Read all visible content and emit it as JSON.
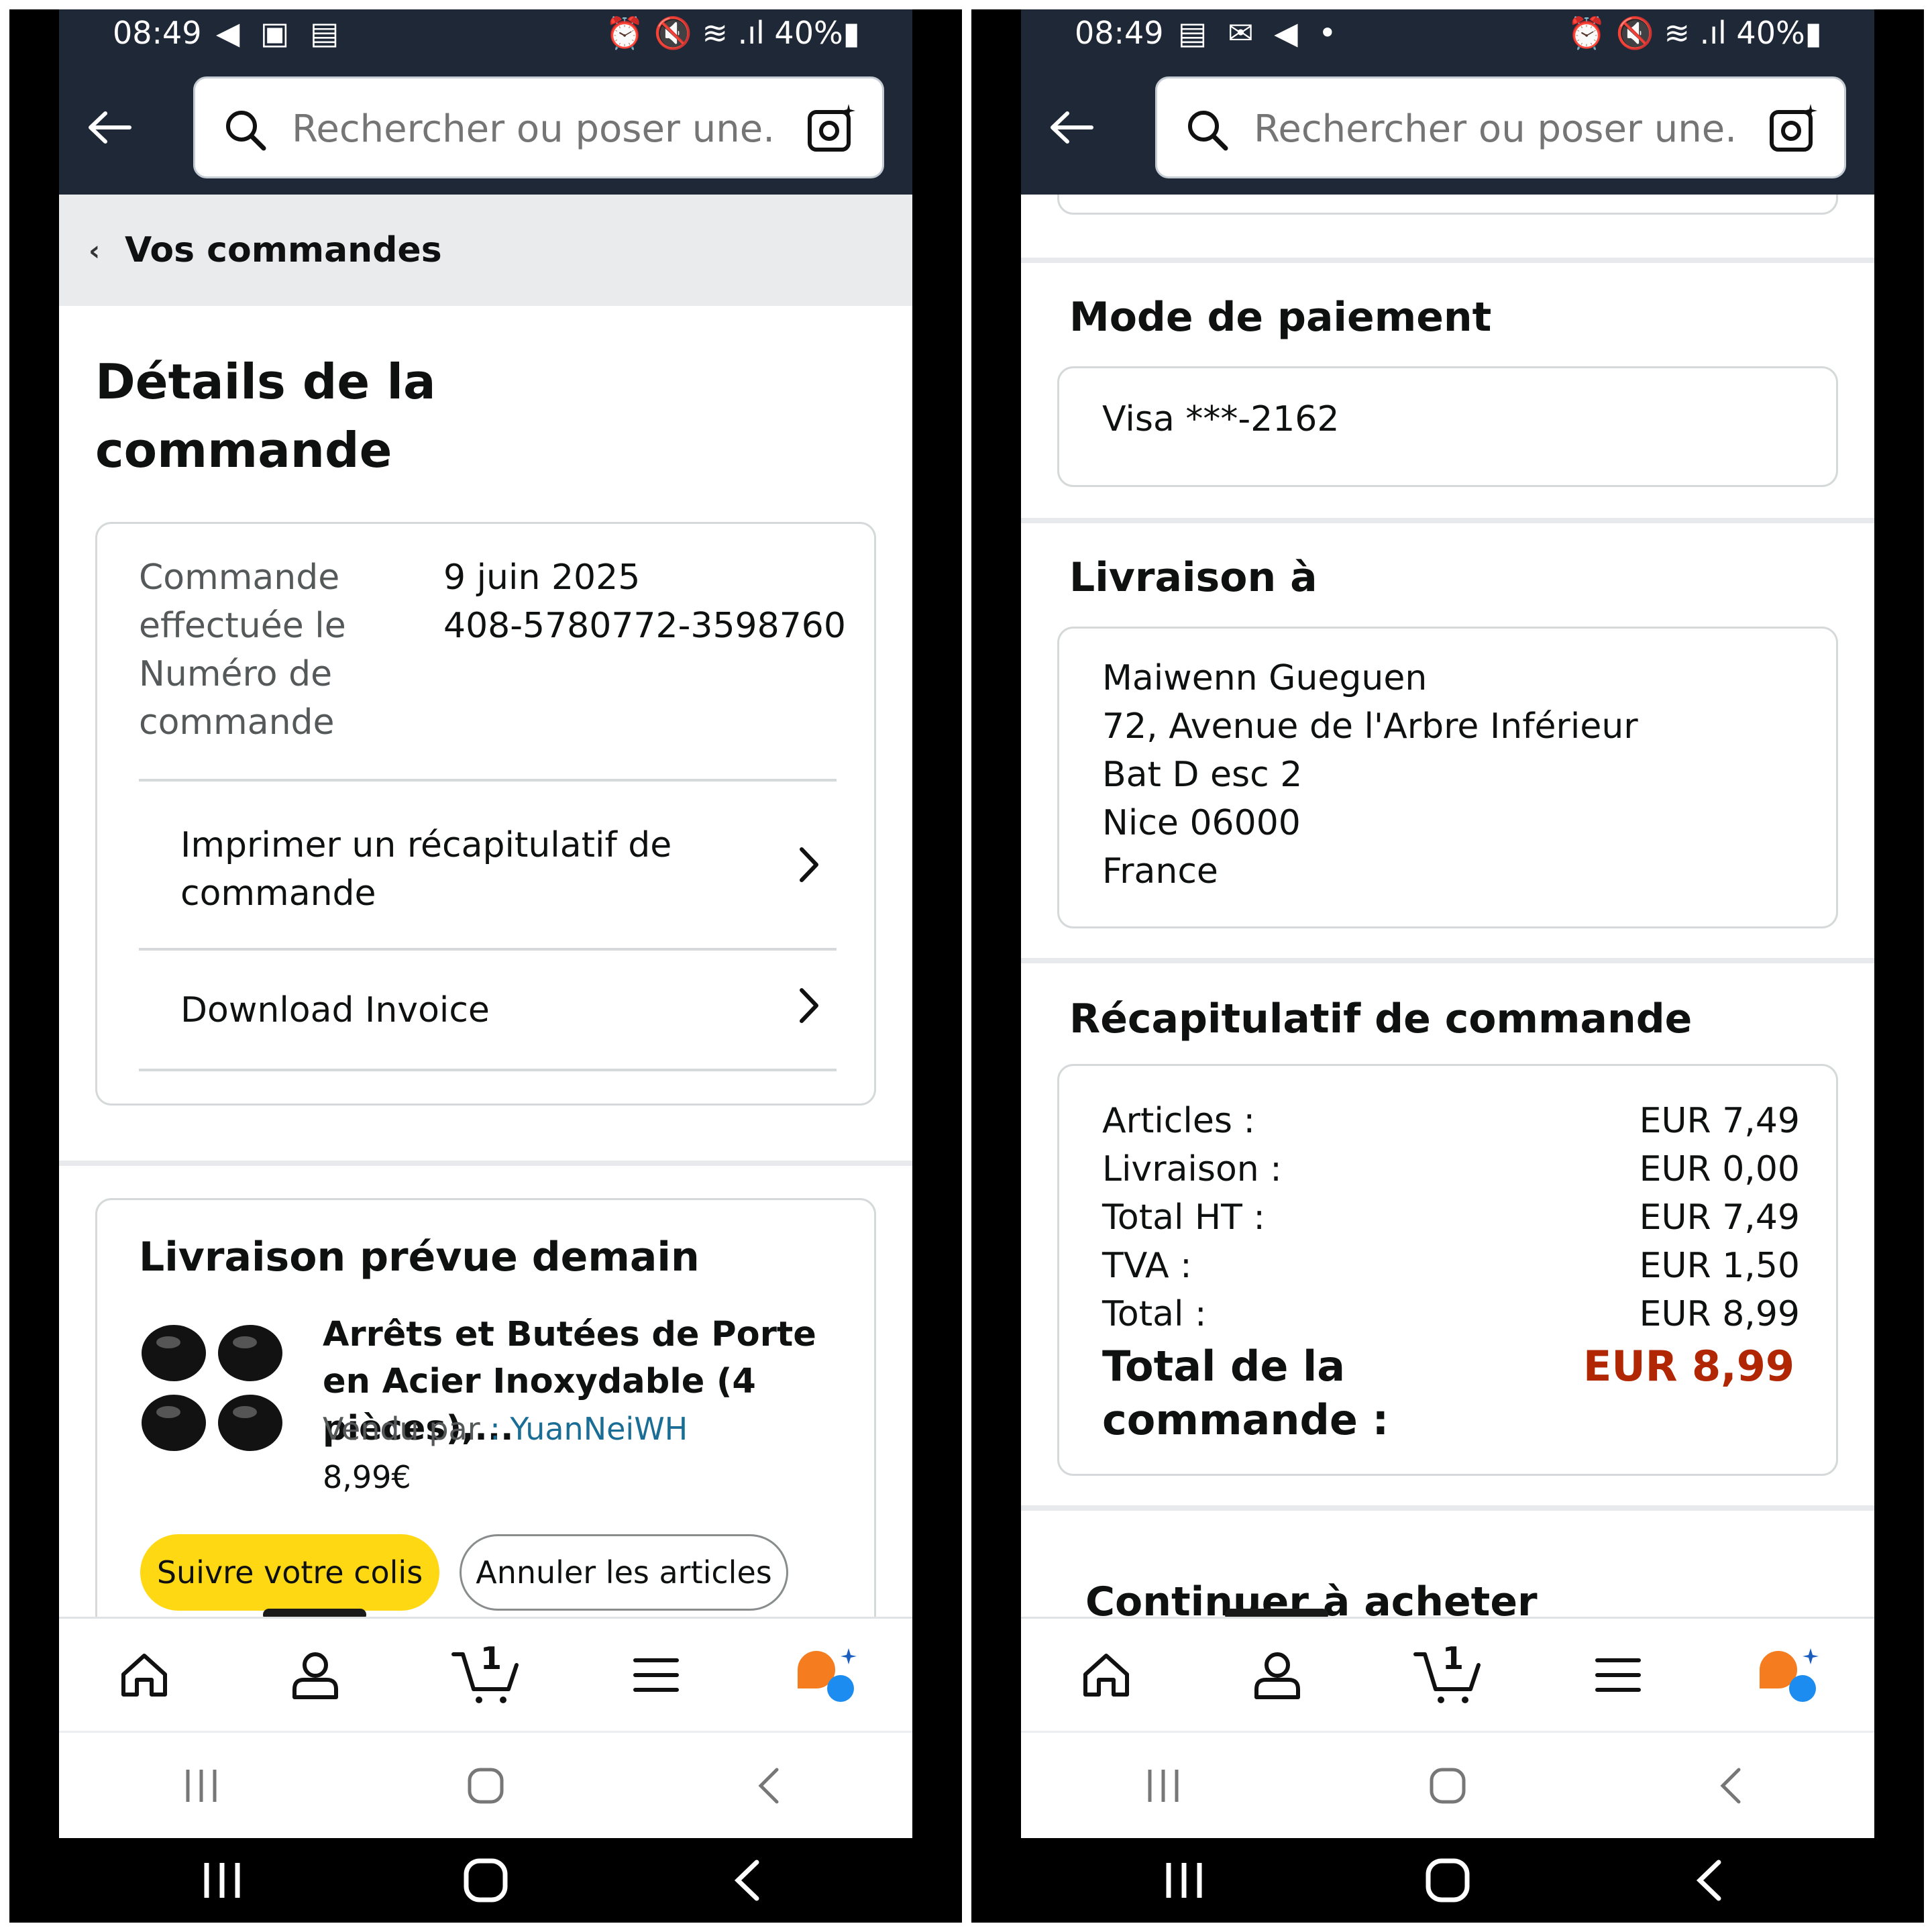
{
  "left": {
    "status": {
      "time": "08:49",
      "icons": "◀ ▣ ▤",
      "right": "⏰ 🔇 ≋ .ıl 40%▮"
    },
    "search": {
      "placeholder": "Rechercher ou poser une..."
    },
    "breadcrumb": "Vos commandes",
    "title": "Détails de la commande",
    "order": {
      "date_label": "Commande effectuée le",
      "number_label": "Numéro de commande",
      "date_value": "9 juin 2025",
      "number_value": "408-5780772-3598760"
    },
    "links": {
      "print": "Imprimer un récapitulatif de commande",
      "invoice": "Download Invoice"
    },
    "delivery": {
      "title": "Livraison prévue demain",
      "product_name": "Arrêts et Butées de Porte en Acier Inoxydable (4 pièces),...",
      "sold_by": "Vendu par",
      "seller": ": YuanNeiWH",
      "price": "8,99€",
      "track_button": "Suivre votre colis",
      "cancel_button": "Annuler les articles"
    },
    "cart_count": "1"
  },
  "right": {
    "status": {
      "time": "08:49",
      "icons": "▤ ✉ ◀ •",
      "right": "⏰ 🔇 ≋ .ıl 40%▮"
    },
    "search": {
      "placeholder": "Rechercher ou poser une..."
    },
    "payment": {
      "title": "Mode de paiement",
      "card": "Visa ***-2162"
    },
    "shipping": {
      "title": "Livraison à",
      "name": "Maiwenn Gueguen",
      "line1": "72, Avenue de l'Arbre Inférieur",
      "line2": "Bat D esc 2",
      "city": "Nice 06000",
      "country": "France"
    },
    "summary": {
      "title": "Récapitulatif de commande",
      "rows": [
        {
          "label": "Articles :",
          "value": "EUR 7,49"
        },
        {
          "label": "Livraison :",
          "value": "EUR 0,00"
        },
        {
          "label": "Total HT :",
          "value": "EUR 7,49"
        },
        {
          "label": "TVA :",
          "value": "EUR 1,50"
        },
        {
          "label": "Total :",
          "value": "EUR 8,99"
        }
      ],
      "grand_total_label": "Total de la commande :",
      "grand_total_value": "EUR 8,99"
    },
    "continue_title": "Continuer à acheter",
    "cart_count": "1"
  },
  "colors": {
    "header": "#1e2836",
    "accent_yellow": "#ffd814",
    "price_red": "#b12704",
    "link": "#1a6e96",
    "rufus_orange": "#f57d1f",
    "rufus_blue": "#1c8cf0"
  },
  "icons": {
    "nav": [
      "home-icon",
      "account-icon",
      "cart-icon",
      "menu-icon",
      "rufus-icon"
    ],
    "system": [
      "recents-icon",
      "home-circle-icon",
      "back-chevron-icon"
    ]
  }
}
